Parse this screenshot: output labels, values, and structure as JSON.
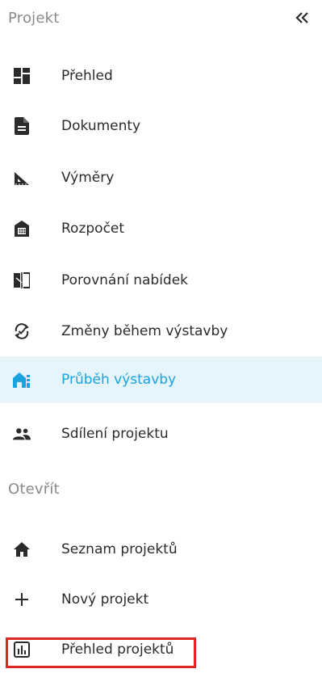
{
  "sections": {
    "projekt_title": "Projekt",
    "otevrit_title": "Otevřít"
  },
  "collapse_icon": "double-chevron-left-icon",
  "projekt_items": [
    {
      "label": "Přehled",
      "icon": "dashboard-icon"
    },
    {
      "label": "Dokumenty",
      "icon": "document-icon"
    },
    {
      "label": "Výměry",
      "icon": "triangle-ruler-icon"
    },
    {
      "label": "Rozpočet",
      "icon": "bank-calculator-icon"
    },
    {
      "label": "Porovnání nabídek",
      "icon": "compare-icon"
    },
    {
      "label": "Změny během výstavby",
      "icon": "change-cycle-icon"
    },
    {
      "label": "Průběh výstavby",
      "icon": "construction-progress-icon",
      "active": true
    },
    {
      "label": "Sdílení projektu",
      "icon": "people-icon"
    }
  ],
  "otevrit_items": [
    {
      "label": "Seznam projektů",
      "icon": "home-icon"
    },
    {
      "label": "Nový projekt",
      "icon": "plus-icon"
    },
    {
      "label": "Přehled projektů",
      "icon": "bar-chart-icon"
    }
  ],
  "colors": {
    "accent": "#1aa3e0",
    "active_bg": "#e6f4fb",
    "icon_dark": "#2b2b2b",
    "section_title": "#8a8a8a",
    "highlight_border": "#e02525"
  }
}
